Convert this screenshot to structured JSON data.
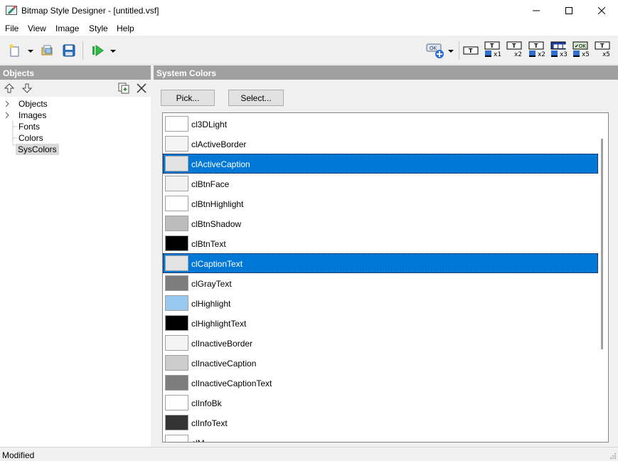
{
  "window": {
    "title": "Bitmap Style Designer - [untitled.vsf]",
    "min_glyph": "—",
    "max_glyph": "☐",
    "close_glyph": "✕"
  },
  "menu": [
    "File",
    "View",
    "Image",
    "Style",
    "Help"
  ],
  "toolbar": {
    "icons": [
      "new-icon",
      "open-icon",
      "save-icon",
      "run-icon",
      "button-preview-icon"
    ],
    "scale_buttons": [
      {
        "name": "scale-x1",
        "label": "x1"
      },
      {
        "name": "scale-x2",
        "label": "x2"
      },
      {
        "name": "scale-x2-alt",
        "label": "x2"
      },
      {
        "name": "scale-x3",
        "label": "x3"
      },
      {
        "name": "scale-x5",
        "label": "x5"
      },
      {
        "name": "scale-x5-alt",
        "label": "x5"
      }
    ]
  },
  "left_panel": {
    "header": "Objects",
    "tree": [
      {
        "label": "Objects",
        "expandable": true,
        "selected": false
      },
      {
        "label": "Images",
        "expandable": true,
        "selected": false
      },
      {
        "label": "Fonts",
        "expandable": false,
        "selected": false
      },
      {
        "label": "Colors",
        "expandable": false,
        "selected": false
      },
      {
        "label": "SysColors",
        "expandable": false,
        "selected": true
      }
    ]
  },
  "right_panel": {
    "header": "System Colors",
    "pick_label": "Pick...",
    "select_label": "Select...",
    "items": [
      {
        "label": "cl3DLight",
        "color": "#ffffff",
        "selected": false
      },
      {
        "label": "clActiveBorder",
        "color": "#f4f4f4",
        "selected": false
      },
      {
        "label": "clActiveCaption",
        "color": "#e3e3e3",
        "selected": true
      },
      {
        "label": "clBtnFace",
        "color": "#f0f0f0",
        "selected": false
      },
      {
        "label": "clBtnHighlight",
        "color": "#ffffff",
        "selected": false
      },
      {
        "label": "clBtnShadow",
        "color": "#bcbcbc",
        "selected": false
      },
      {
        "label": "clBtnText",
        "color": "#000000",
        "selected": false
      },
      {
        "label": "clCaptionText",
        "color": "#e3e3e3",
        "selected": true
      },
      {
        "label": "clGrayText",
        "color": "#7d7d7d",
        "selected": false
      },
      {
        "label": "clHighlight",
        "color": "#99c9ef",
        "selected": false
      },
      {
        "label": "clHighlightText",
        "color": "#000000",
        "selected": false
      },
      {
        "label": "clInactiveBorder",
        "color": "#f4f4f4",
        "selected": false
      },
      {
        "label": "clInactiveCaption",
        "color": "#cccccc",
        "selected": false
      },
      {
        "label": "clInactiveCaptionText",
        "color": "#7d7d7d",
        "selected": false
      },
      {
        "label": "clInfoBk",
        "color": "#ffffff",
        "selected": false
      },
      {
        "label": "clInfoText",
        "color": "#333333",
        "selected": false
      },
      {
        "label": "clM",
        "color": "#ffffff",
        "selected": false
      }
    ]
  },
  "status": {
    "text": "Modified"
  },
  "colors": {
    "selection": "#0078d7",
    "panel_header": "#a0a0a0",
    "tree_selected": "#cce8ff"
  }
}
